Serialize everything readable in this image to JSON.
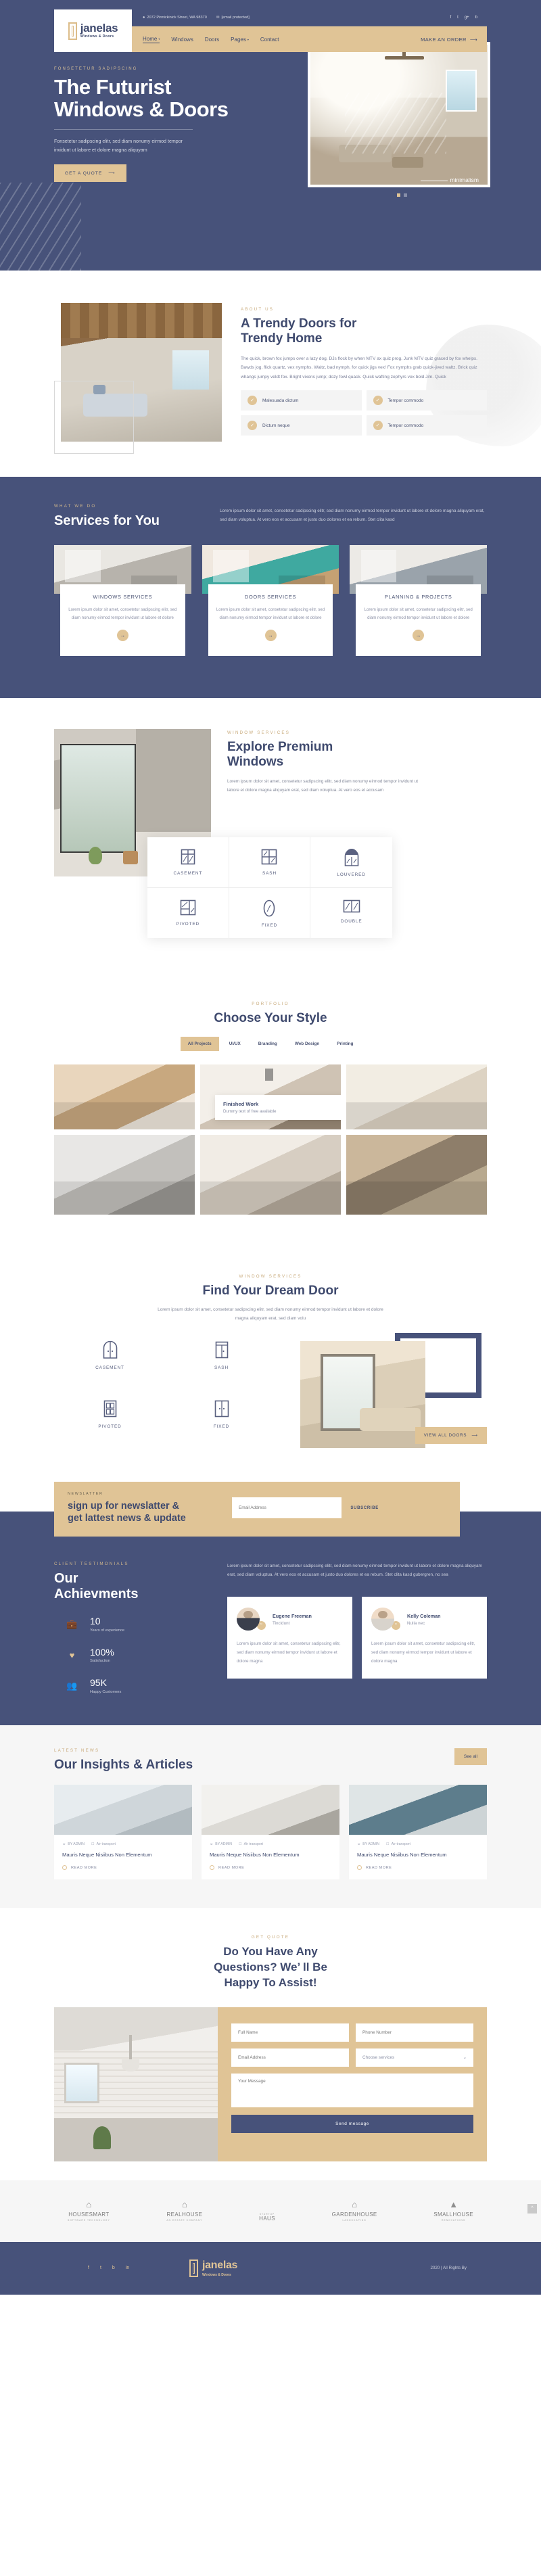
{
  "header": {
    "logo": {
      "name": "janelas",
      "sub": "Windows & Doors"
    },
    "address": "2072 Pinnickinick Street, WA 98370",
    "email": "[email protected]",
    "socials": [
      "f",
      "t",
      "g+",
      "b"
    ],
    "nav": [
      {
        "label": "Home",
        "caret": "▾"
      },
      {
        "label": "Windows",
        "caret": ""
      },
      {
        "label": "Doors",
        "caret": ""
      },
      {
        "label": "Pages",
        "caret": "▾"
      },
      {
        "label": "Contact",
        "caret": ""
      }
    ],
    "cta": "MAKE AN ORDER"
  },
  "hero": {
    "eyebrow": "FONSETETUR SADIPSCING",
    "title_line1": "The Futurist",
    "title_line2": "Windows & Doors",
    "desc": "Fonsetetur sadipscing elitr, sed diam nonumy eirmod tempor invidunt ut labore et dolore magna aliquyam",
    "button": "GET A QUOTE",
    "caption": "minimalism"
  },
  "about": {
    "eyebrow": "ABOUT US",
    "title_line1": "A Trendy Doors for",
    "title_line2": "Trendy Home",
    "text": "The quick, brown fox jumps over a lazy dog. DJs flock by when MTV ax quiz prog. Junk MTV quiz graced by fox whelps. Bawds jog, flick quartz, vex nymphs. Waltz, bad nymph, for quick jigs vex! Fox nymphs grab quick-jived waltz. Brick quiz whangs jumpy veldt fox. Bright vixens jump; dozy fowl quack. Quick wafting zephyrs vex bold Jim. Quick",
    "features": [
      "Malesuada dictum",
      "Tempor commodo",
      "Dictum neque",
      "Tempor commodo"
    ]
  },
  "services": {
    "eyebrow": "WHAT WE DO",
    "title": "Services for You",
    "intro": "Lorem ipsum dolor sit amet, consetetur sadipscing elitr, sed diam nonumy eirmod tempor invidunt ut labore et dolore magna aliquyam erat, sed diam voluptua. At vero eos et accusam et justo duo dolores et ea rebum. Stet clita kasd",
    "cards": [
      {
        "name": "WINDOWS SERVICES",
        "desc": "Lorem ipsum dolor sit amet, consetetur sadipscing elitr, sed diam nonumy eirmod tempor invidunt ut labore et dolore"
      },
      {
        "name": "DOORS SERVICES",
        "desc": "Lorem ipsum dolor sit amet, consetetur sadipscing elitr, sed diam nonumy eirmod tempor invidunt ut labore et dolore"
      },
      {
        "name": "PLANNING & PROJECTS",
        "desc": "Lorem ipsum dolor sit amet, consetetur sadipscing elitr, sed diam nonumy eirmod tempor invidunt ut labore et dolore"
      }
    ]
  },
  "explore": {
    "eyebrow": "WINDOW SERVICES",
    "title_line1": "Explore Premium",
    "title_line2": "Windows",
    "desc": "Lorem ipsum dolor sit amet, consetetur sadipscing elitr, sed diam nonumy eirmod tempor invidunt ut labore et dolore magna aliquyam erat, sed diam voluptua. At vero eos et accusam",
    "types": [
      "CASEMENT",
      "SASH",
      "LOUVERED",
      "PIVOTED",
      "FIXED",
      "DOUBLE"
    ]
  },
  "portfolio": {
    "eyebrow": "PORTFOLIO",
    "title": "Choose Your Style",
    "filters": [
      "All Projects",
      "UI/UX",
      "Branding",
      "Web Design",
      "Printing"
    ],
    "caption_title": "Finished Work",
    "caption_sub": "Dummy text of free available"
  },
  "dream": {
    "eyebrow": "WINDOW SERVICES",
    "title": "Find Your Dream Door",
    "desc": "Lorem ipsum dolor sit amet, consetetur sadipscing elitr, sed diam nonumy eirmod tempor invidunt ut labore et dolore magna aliquyam erat, sed diam volu",
    "types": [
      "CASEMENT",
      "SASH",
      "PIVOTED",
      "FIXED"
    ],
    "button": "VIEW ALL DOORS"
  },
  "newsletter": {
    "eyebrow": "NEWSLATTER",
    "title_line1": "sign up for newslatter &",
    "title_line2": "get lattest news & update",
    "placeholder": "Email Address",
    "button": "SUBSCRIBE"
  },
  "achievements": {
    "eyebrow": "CLIENT TESTIMONIALS",
    "title_line1": "Our",
    "title_line2": "Achievments",
    "copy": "Lorem ipsum dolor sit amet, consetetur sadipscing elitr, sed diam nonumy eirmod tempor invidunt ut labore et dolore magna aliquyam erat, sed diam voluptua. At vero eos et accusam et justo duo dolores et ea rebum. Stet clita kasd gubergren, no sea",
    "stats": [
      {
        "icon": "briefcase-icon",
        "glyph": "💼",
        "value": "10",
        "label": "Years of experience"
      },
      {
        "icon": "heart-icon",
        "glyph": "♥",
        "value": "100%",
        "label": "Satisfaction"
      },
      {
        "icon": "people-icon",
        "glyph": "👥",
        "value": "95K",
        "label": "Happy Customers"
      }
    ],
    "testimonials": [
      {
        "name": "Eugene Freeman",
        "role": "Tincidunt",
        "text": "Lorem ipsum dolor sit amet, consetetur sadipscing elitr, sed diam nonumy eirmod tempor invidunt ut labore et dolore magna"
      },
      {
        "name": "Kelly Coleman",
        "role": "Nulla nec",
        "text": "Lorem ipsum dolor sit amet, consetetur sadipscing elitr, sed diam nonumy eirmod tempor invidunt ut labore et dolore magna"
      }
    ]
  },
  "blog": {
    "eyebrow": "LATEST NEWS",
    "title": "Our Insights & Articles",
    "see_all": "See all",
    "posts": [
      {
        "author": "BY ADMIN",
        "category": "Air transport",
        "title": "Mauris Neque Nisiibus Non Elementum",
        "more": "READ MORE"
      },
      {
        "author": "BY ADMIN",
        "category": "Air transport",
        "title": "Mauris Neque Nisiibus Non Elementum",
        "more": "READ MORE"
      },
      {
        "author": "BY ADMIN",
        "category": "Air transport",
        "title": "Mauris Neque Nisiibus Non Elementum",
        "more": "READ MORE"
      }
    ]
  },
  "contact": {
    "eyebrow": "GET QUOTE",
    "title_line1": "Do You Have Any",
    "title_line2": "Questions? We’  ll Be",
    "title_line3": "Happy To Assist!",
    "fields": {
      "full_name": "Full Name",
      "phone": "Phone Number",
      "email": "Email Address",
      "service": "Choose services",
      "message": "Your Message"
    },
    "submit": "Send message"
  },
  "partners": [
    {
      "name": "HOUSESMART",
      "sub": "SOFTWARE TECHNOLOGY",
      "mark": "⌂"
    },
    {
      "name": "REALHOUSE",
      "sub": "AN ESTATE COMPANY",
      "mark": "⌂"
    },
    {
      "name": "HAUS",
      "sub": "STARTUP",
      "mark": ""
    },
    {
      "name": "GARDENHOUSE",
      "sub": "LANDSCAPING",
      "mark": "⌂"
    },
    {
      "name": "SMALLHOUSE",
      "sub": "RENOVATIONS",
      "mark": "▲"
    }
  ],
  "footer": {
    "socials": [
      "f",
      "t",
      "b",
      "in"
    ],
    "logo": {
      "name": "janelas",
      "sub": "Windows & Doors"
    },
    "copyright": "2020 | All Rights By"
  },
  "colors": {
    "navy": "#47527a",
    "sand": "#e0c496",
    "light": "#f6f6f6"
  }
}
